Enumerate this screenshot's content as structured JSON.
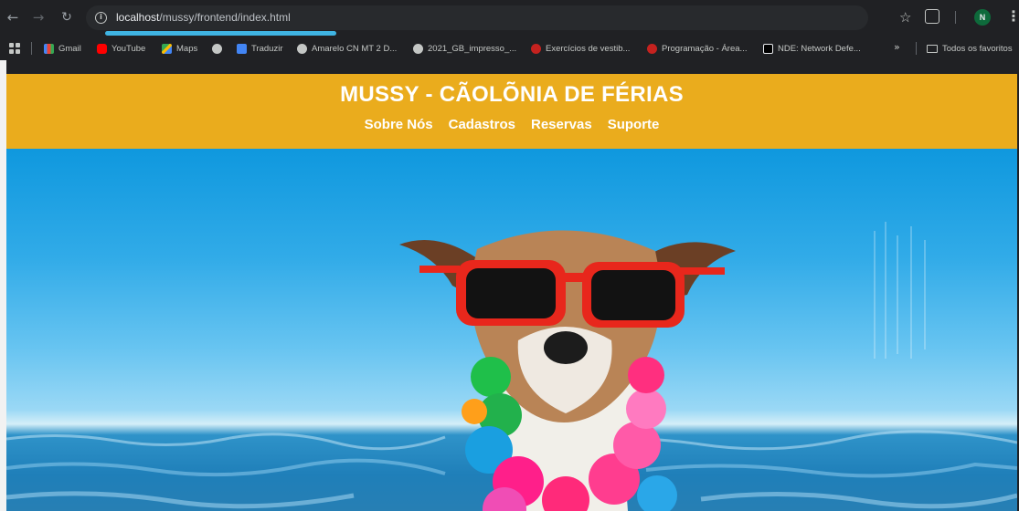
{
  "browser": {
    "url_host": "localhost",
    "url_path": "/mussy/frontend/index.html",
    "profile_initial": "N",
    "bookmarks": [
      {
        "label": "Gmail",
        "icon": "gmail-icon"
      },
      {
        "label": "YouTube",
        "icon": "youtube-icon"
      },
      {
        "label": "Maps",
        "icon": "maps-icon"
      },
      {
        "label": "",
        "icon": "globe-icon"
      },
      {
        "label": "Traduzir",
        "icon": "translate-icon"
      },
      {
        "label": "Amarelo CN MT 2 D...",
        "icon": "globe-icon"
      },
      {
        "label": "2021_GB_impresso_...",
        "icon": "globe-icon"
      },
      {
        "label": "Exercícios de vestib...",
        "icon": "site-icon"
      },
      {
        "label": "Programação - Área...",
        "icon": "site-icon"
      },
      {
        "label": "NDE: Network Defe...",
        "icon": "nde-icon"
      }
    ],
    "more_bookmarks": "»",
    "all_bookmarks_label": "Todos os favoritos"
  },
  "site": {
    "title": "MUSSY - CÃOLÕNIA DE FÉRIAS",
    "nav": [
      "Sobre Nós",
      "Cadastros",
      "Reservas",
      "Suporte"
    ]
  },
  "colors": {
    "header": "#eaac1d",
    "sky": "#31abe8",
    "sea": "#1f7fb9",
    "sunglasses_frame": "#e8271c"
  }
}
